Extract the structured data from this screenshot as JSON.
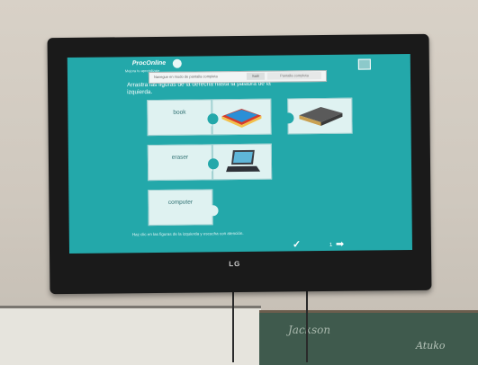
{
  "app": {
    "brand": "ProcOnline",
    "brand_sub": "Mejora tu aprendizaje"
  },
  "popup": {
    "text": "Navegue en modo de pantalla completa",
    "button1": "Salir",
    "button2": "Pantalla completa"
  },
  "exercise": {
    "instruction_line1": "Arrastra las figuras de la derecha hasta la palabra de la",
    "instruction_line2": "izquierda.",
    "words": [
      "book",
      "eraser",
      "computer"
    ],
    "footer": "Haz clic en las figuras de la izquierda y escucha con atención."
  },
  "nav": {
    "page": "1"
  },
  "environment": {
    "tv_brand": "LG",
    "chalk_text_1": "Jackson",
    "chalk_text_2": "Atuko"
  },
  "colors": {
    "screen_bg": "#23a8aa",
    "piece_bg": "#dff2f1",
    "word_text": "#2c6e70"
  }
}
